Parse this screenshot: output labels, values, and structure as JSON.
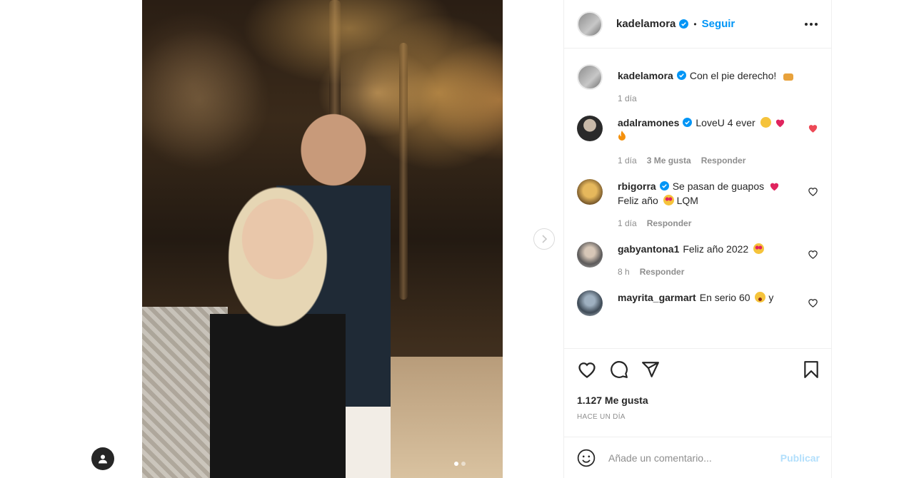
{
  "post": {
    "author": "kadelamora",
    "follow_label": "Seguir",
    "separator": "•",
    "caption": {
      "user": "kadelamora",
      "text": "Con el pie derecho!",
      "time": "1 día"
    },
    "comments": [
      {
        "user": "adalramones",
        "text": "LoveU 4 ever",
        "time": "1 día",
        "likes": "3 Me gusta",
        "reply": "Responder",
        "liked": true
      },
      {
        "user": "rbigorra",
        "text": "Se pasan de guapos",
        "text2": "Feliz año",
        "text3": "LQM",
        "time": "1 día",
        "reply": "Responder",
        "liked": false
      },
      {
        "user": "gabyantona1",
        "text": "Feliz año 2022",
        "time": "8 h",
        "reply": "Responder",
        "liked": false
      },
      {
        "user": "mayrita_garmart",
        "text": "En serio 60",
        "text2": "y",
        "liked": false
      }
    ],
    "likes_label": "1.127 Me gusta",
    "time_label": "HACE UN DÍA",
    "comment_placeholder": "Añade un comentario...",
    "publish_label": "Publicar"
  },
  "colors": {
    "accent": "#0095f6",
    "like_red": "#ed4956",
    "muted": "#8e8e8e",
    "publish_disabled": "#b2dffc"
  },
  "icons": [
    "verified-icon",
    "more-icon",
    "heart-icon",
    "comment-icon",
    "share-icon",
    "bookmark-icon",
    "emoji-icon",
    "chevron-right-icon",
    "user-tag-icon"
  ]
}
